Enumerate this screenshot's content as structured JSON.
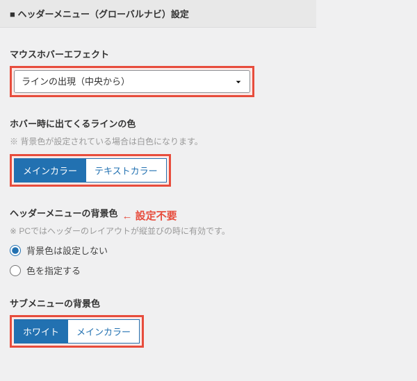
{
  "section_header": "■ ヘッダーメニュー（グローバルナビ）設定",
  "hover_effect": {
    "label": "マウスホバーエフェクト",
    "selected": "ラインの出現（中央から）"
  },
  "hover_line_color": {
    "label": "ホバー時に出てくるラインの色",
    "note": "※ 背景色が設定されている場合は白色になります。",
    "options": {
      "main": "メインカラー",
      "text": "テキストカラー"
    }
  },
  "header_bg": {
    "label": "ヘッダーメニューの背景色",
    "inline_note": "← 設定不要",
    "note": "※ PCではヘッダーのレイアウトが縦並びの時に有効です。",
    "radio_none": "背景色は設定しない",
    "radio_color": "色を指定する"
  },
  "submenu_bg": {
    "label": "サブメニューの背景色",
    "options": {
      "white": "ホワイト",
      "main": "メインカラー"
    }
  }
}
